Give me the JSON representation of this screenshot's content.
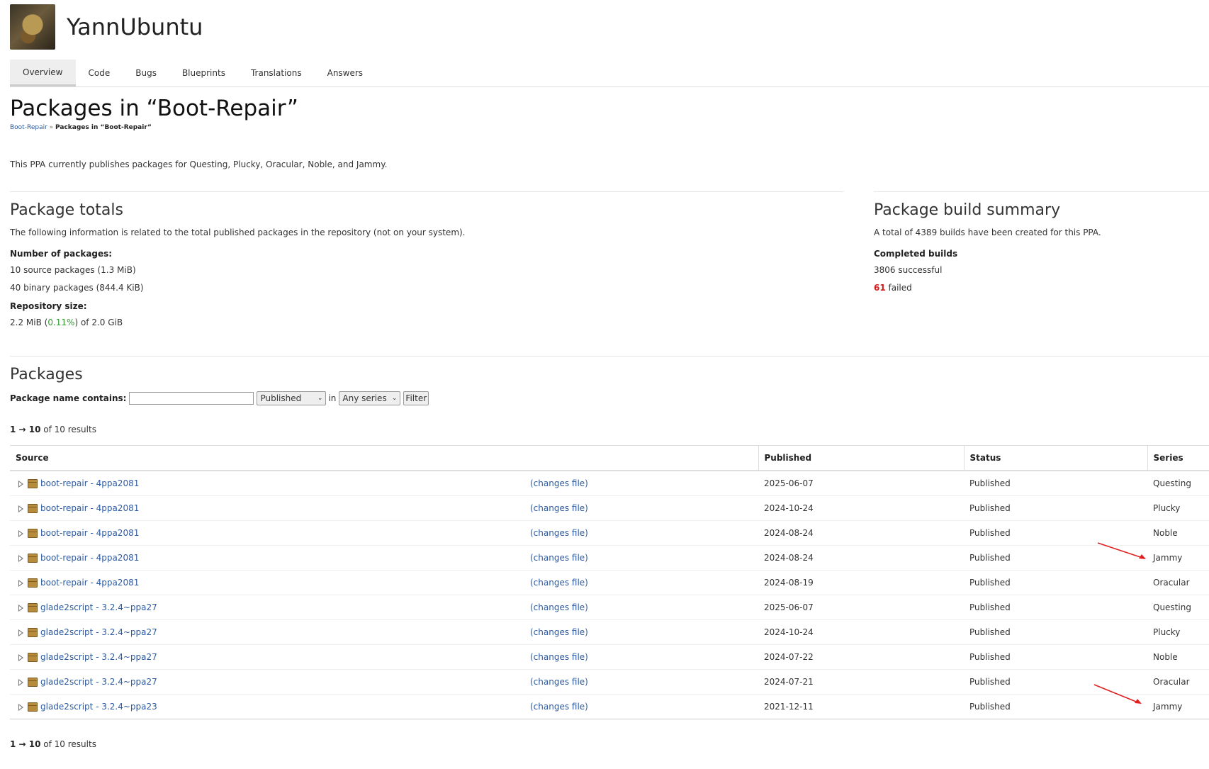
{
  "site": {
    "title": "YannUbuntu"
  },
  "tabs": [
    {
      "label": "Overview",
      "active": true
    },
    {
      "label": "Code"
    },
    {
      "label": "Bugs"
    },
    {
      "label": "Blueprints"
    },
    {
      "label": "Translations"
    },
    {
      "label": "Answers"
    }
  ],
  "page": {
    "title": "Packages in “Boot-Repair”"
  },
  "breadcrumb": {
    "parent": "Boot-Repair",
    "separator": "»",
    "current": "Packages in “Boot-Repair”"
  },
  "intro": "This PPA currently publishes packages for Questing, Plucky, Oracular, Noble, and Jammy.",
  "totals": {
    "heading": "Package totals",
    "description": "The following information is related to the total published packages in the repository (not on your system).",
    "num_label": "Number of packages:",
    "source": "10 source packages (1.3 MiB)",
    "binary": "40 binary packages (844.4 KiB)",
    "repo_label": "Repository size:",
    "repo_used": "2.2 MiB (",
    "repo_pct": "0.11%",
    "repo_rest": ") of 2.0 GiB"
  },
  "builds": {
    "heading": "Package build summary",
    "description": "A total of 4389 builds have been created for this PPA.",
    "completed_label": "Completed builds",
    "successful": "3806 successful",
    "failed_count": "61",
    "failed_label": " failed"
  },
  "packages": {
    "heading": "Packages",
    "filter_label": "Package name contains:",
    "filter_value": "",
    "status_select": "Published",
    "in_label": "in",
    "series_select": "Any series",
    "filter_button": "Filter",
    "results_range": "1 → 10",
    "results_rest": " of 10 results",
    "columns": {
      "source": "Source",
      "published": "Published",
      "status": "Status",
      "series": "Series"
    },
    "rows": [
      {
        "name": "boot-repair - 4ppa2081",
        "changes": "(changes file)",
        "published": "2025-06-07",
        "status": "Published",
        "series": "Questing"
      },
      {
        "name": "boot-repair - 4ppa2081",
        "changes": "(changes file)",
        "published": "2024-10-24",
        "status": "Published",
        "series": "Plucky"
      },
      {
        "name": "boot-repair - 4ppa2081",
        "changes": "(changes file)",
        "published": "2024-08-24",
        "status": "Published",
        "series": "Noble"
      },
      {
        "name": "boot-repair - 4ppa2081",
        "changes": "(changes file)",
        "published": "2024-08-24",
        "status": "Published",
        "series": "Jammy"
      },
      {
        "name": "boot-repair - 4ppa2081",
        "changes": "(changes file)",
        "published": "2024-08-19",
        "status": "Published",
        "series": "Oracular"
      },
      {
        "name": "glade2script - 3.2.4~ppa27",
        "changes": "(changes file)",
        "published": "2025-06-07",
        "status": "Published",
        "series": "Questing"
      },
      {
        "name": "glade2script - 3.2.4~ppa27",
        "changes": "(changes file)",
        "published": "2024-10-24",
        "status": "Published",
        "series": "Plucky"
      },
      {
        "name": "glade2script - 3.2.4~ppa27",
        "changes": "(changes file)",
        "published": "2024-07-22",
        "status": "Published",
        "series": "Noble"
      },
      {
        "name": "glade2script - 3.2.4~ppa27",
        "changes": "(changes file)",
        "published": "2024-07-21",
        "status": "Published",
        "series": "Oracular"
      },
      {
        "name": "glade2script - 3.2.4~ppa23",
        "changes": "(changes file)",
        "published": "2021-12-11",
        "status": "Published",
        "series": "Jammy"
      }
    ]
  },
  "annotation_color": "#e02020"
}
